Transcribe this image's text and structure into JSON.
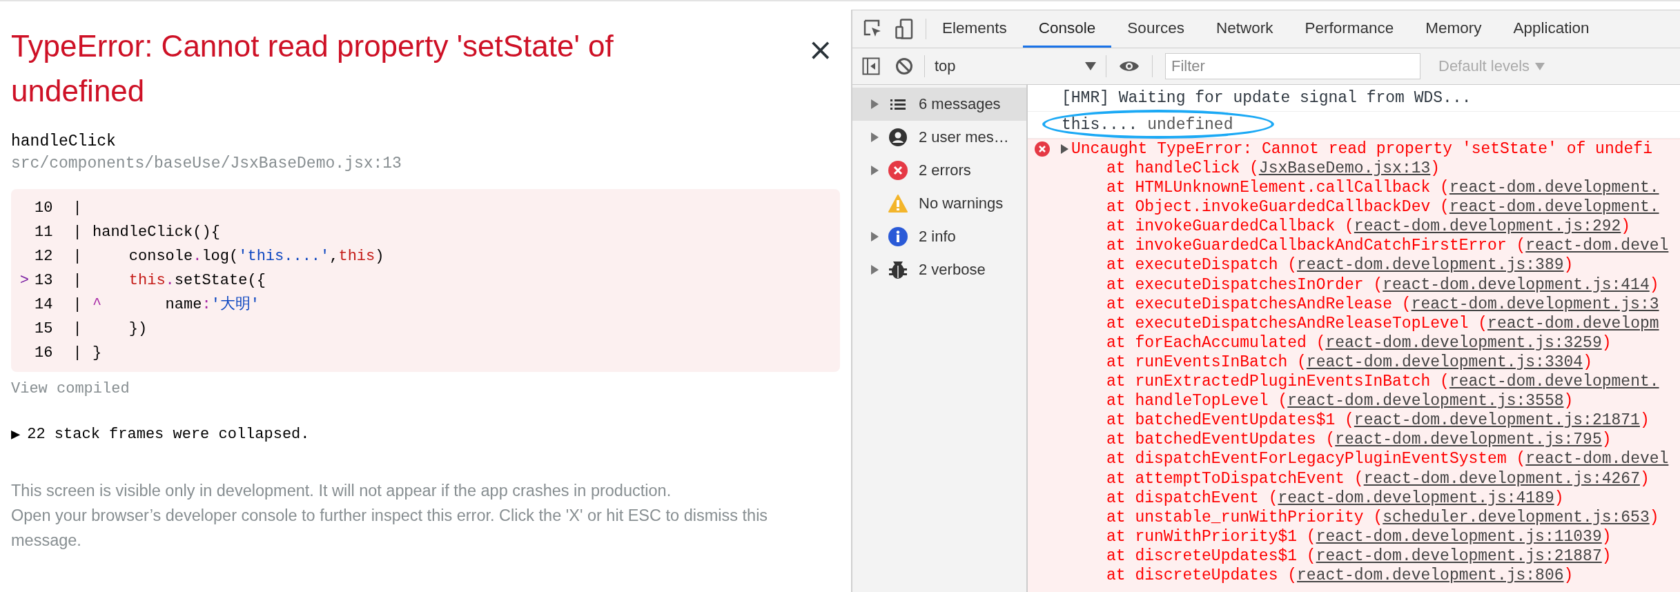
{
  "overlay": {
    "title": "TypeError: Cannot read property 'setState' of undefined",
    "close": "×",
    "function_name": "handleClick",
    "file_path": "src/components/baseUse/JsxBaseDemo.jsx:13",
    "code_lines": [
      {
        "number": "10",
        "separator": "|"
      },
      {
        "number": "11",
        "separator": "|",
        "indented": false,
        "segments": [
          {
            "kind": "plain",
            "text": "handleClick(){"
          }
        ]
      },
      {
        "number": "12",
        "separator": "|",
        "indented": true,
        "segments": [
          {
            "kind": "plain",
            "text": "console"
          },
          {
            "kind": "punct",
            "text": "."
          },
          {
            "kind": "plain",
            "text": "log("
          },
          {
            "kind": "string",
            "text": "'this....'"
          },
          {
            "kind": "plain",
            "text": ","
          },
          {
            "kind": "keyword",
            "text": "this"
          },
          {
            "kind": "plain",
            "text": ")"
          }
        ]
      },
      {
        "number": "13",
        "pointer": ">",
        "separator": "|",
        "indented": true,
        "segments": [
          {
            "kind": "keyword",
            "text": "this"
          },
          {
            "kind": "punct",
            "text": "."
          },
          {
            "kind": "plain",
            "text": "setState({"
          }
        ]
      },
      {
        "number": "14",
        "separator": "|",
        "indented": false,
        "segments": [
          {
            "kind": "punct",
            "text": "^"
          },
          {
            "kind": "plain",
            "text": "       name"
          },
          {
            "kind": "punct",
            "text": ":"
          },
          {
            "kind": "string",
            "text": "'大明'"
          }
        ]
      },
      {
        "number": "15",
        "separator": "|",
        "indented": true,
        "segments": [
          {
            "kind": "plain",
            "text": "})"
          }
        ]
      },
      {
        "number": "16",
        "separator": "|",
        "indented": false,
        "segments": [
          {
            "kind": "plain",
            "text": "}"
          }
        ]
      }
    ],
    "view_compiled": "View compiled",
    "collapsed_arrow": "▶",
    "collapsed_text": "22 stack frames were collapsed.",
    "footer": [
      "This screen is visible only in development. It will not appear if the app crashes in production.",
      "Open your browser’s developer console to further inspect this error.  Click the 'X' or hit ESC to dismiss this message."
    ]
  },
  "devtools": {
    "tabs": [
      {
        "label": "Elements",
        "selected": false
      },
      {
        "label": "Console",
        "selected": true
      },
      {
        "label": "Sources",
        "selected": false
      },
      {
        "label": "Network",
        "selected": false
      },
      {
        "label": "Performance",
        "selected": false
      },
      {
        "label": "Memory",
        "selected": false
      },
      {
        "label": "Application",
        "selected": false
      }
    ],
    "context": "top",
    "filter_placeholder": "Filter",
    "levels": "Default levels",
    "sidebar": [
      {
        "kind": "list",
        "label": "6 messages",
        "expandable": true,
        "selected": true
      },
      {
        "kind": "user",
        "label": "2 user mes…",
        "expandable": true,
        "selected": false
      },
      {
        "kind": "error",
        "label": "2 errors",
        "expandable": true,
        "selected": false
      },
      {
        "kind": "warning",
        "label": "No warnings",
        "expandable": false,
        "selected": false
      },
      {
        "kind": "info",
        "label": "2 info",
        "expandable": true,
        "selected": false
      },
      {
        "kind": "verbose",
        "label": "2 verbose",
        "expandable": true,
        "selected": false
      }
    ],
    "messages": [
      {
        "kind": "log",
        "text": "[HMR] Waiting for update signal from WDS...",
        "circled": false
      },
      {
        "kind": "log",
        "text": "this....",
        "value": "undefined",
        "circled": true
      },
      {
        "kind": "error",
        "text": "Uncaught TypeError: Cannot read property 'setState' of undefi",
        "stack": [
          {
            "prefix": "at handleClick (",
            "link": "JsxBaseDemo.jsx:13",
            "suffix": ")"
          },
          {
            "prefix": "at HTMLUnknownElement.callCallback (",
            "link": "react-dom.development."
          },
          {
            "prefix": "at Object.invokeGuardedCallbackDev (",
            "link": "react-dom.development."
          },
          {
            "prefix": "at invokeGuardedCallback (",
            "link": "react-dom.development.js:292",
            "suffix": ")"
          },
          {
            "prefix": "at invokeGuardedCallbackAndCatchFirstError (",
            "link": "react-dom.devel"
          },
          {
            "prefix": "at executeDispatch (",
            "link": "react-dom.development.js:389",
            "suffix": ")"
          },
          {
            "prefix": "at executeDispatchesInOrder (",
            "link": "react-dom.development.js:414",
            "suffix": ")"
          },
          {
            "prefix": "at executeDispatchesAndRelease (",
            "link": "react-dom.development.js:3"
          },
          {
            "prefix": "at executeDispatchesAndReleaseTopLevel (",
            "link": "react-dom.developm"
          },
          {
            "prefix": "at forEachAccumulated (",
            "link": "react-dom.development.js:3259",
            "suffix": ")"
          },
          {
            "prefix": "at runEventsInBatch (",
            "link": "react-dom.development.js:3304",
            "suffix": ")"
          },
          {
            "prefix": "at runExtractedPluginEventsInBatch (",
            "link": "react-dom.development."
          },
          {
            "prefix": "at handleTopLevel (",
            "link": "react-dom.development.js:3558",
            "suffix": ")"
          },
          {
            "prefix": "at batchedEventUpdates$1 (",
            "link": "react-dom.development.js:21871",
            "suffix": ")"
          },
          {
            "prefix": "at batchedEventUpdates (",
            "link": "react-dom.development.js:795",
            "suffix": ")"
          },
          {
            "prefix": "at dispatchEventForLegacyPluginEventSystem (",
            "link": "react-dom.devel"
          },
          {
            "prefix": "at attemptToDispatchEvent (",
            "link": "react-dom.development.js:4267",
            "suffix": ")"
          },
          {
            "prefix": "at dispatchEvent (",
            "link": "react-dom.development.js:4189",
            "suffix": ")"
          },
          {
            "prefix": "at unstable_runWithPriority (",
            "link": "scheduler.development.js:653",
            "suffix": ")"
          },
          {
            "prefix": "at runWithPriority$1 (",
            "link": "react-dom.development.js:11039",
            "suffix": ")"
          },
          {
            "prefix": "at discreteUpdates$1 (",
            "link": "react-dom.development.js:21887",
            "suffix": ")"
          },
          {
            "prefix": "at discreteUpdates (",
            "link": "react-dom.development.js:806",
            "suffix": ")"
          }
        ]
      }
    ]
  }
}
